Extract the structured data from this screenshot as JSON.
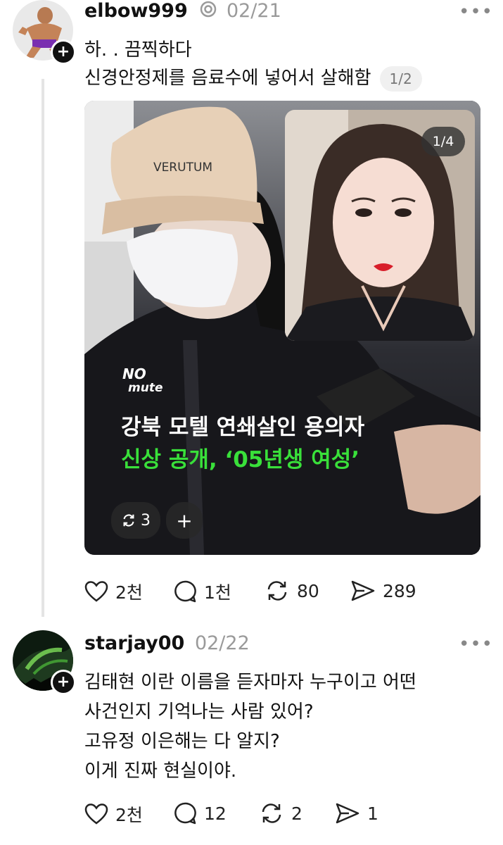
{
  "post1": {
    "username": "elbow999",
    "date": "02/21",
    "line1": "하. . 끔찍하다",
    "line2": "신경안정제를 음료수에 넣어서 살해함",
    "text_page": "1/2",
    "media": {
      "counter": "1/4",
      "cap_text": "VERUTUM",
      "brand_line1": "NO",
      "brand_line2": "mute",
      "headline1": "강북 모텔 연쇄살인 용의자",
      "headline2": "신상 공개, ‘05년생 여성’",
      "repost_count": "3",
      "add_label": "+"
    },
    "actions": {
      "likes": "2천",
      "comments": "1천",
      "reposts": "80",
      "shares": "289"
    }
  },
  "post2": {
    "username": "starjay00",
    "date": "02/22",
    "lines": [
      "김태현 이란 이름을 듣자마자 누구이고 어떤",
      "사건인지 기억나는 사람 있어?",
      "고유정 이은해는 다 알지?",
      "이게 진짜 현실이야."
    ],
    "actions": {
      "likes": "2천",
      "comments": "12",
      "reposts": "2",
      "shares": "1"
    }
  },
  "colors": {
    "headline_white": "#ffffff",
    "headline_green": "#39e03a",
    "date_gray": "#9a9a9a",
    "thread_line": "#e4e4e4"
  },
  "icons": [
    "more-icon",
    "plus-icon",
    "heart-icon",
    "comment-icon",
    "repost-icon",
    "share-icon",
    "self-repost-icon"
  ]
}
